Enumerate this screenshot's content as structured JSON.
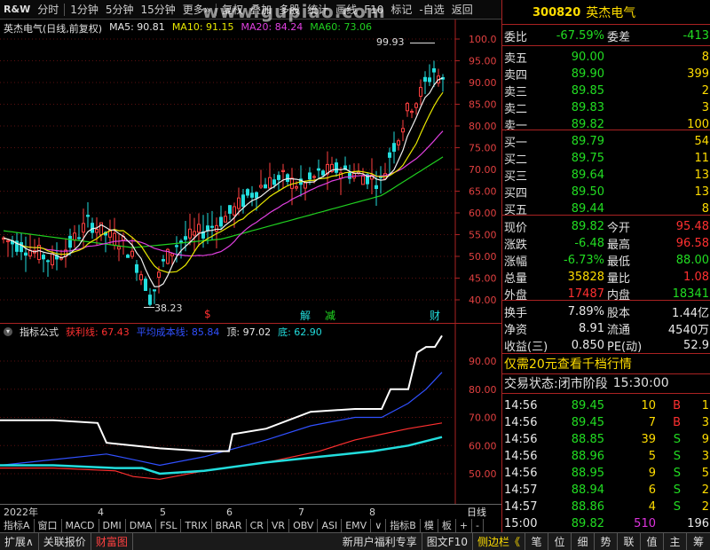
{
  "toolbar": {
    "logo_text": "R&W",
    "items": [
      "分时",
      "1分钟",
      "5分钟",
      "15分钟",
      "更多»",
      "复权",
      "叠加",
      "多股",
      "统计",
      "画线",
      "F10",
      "标记",
      "-自选",
      "返回"
    ]
  },
  "watermark": "www.gupiao.com",
  "chart": {
    "title": "英杰电气(日线,前复权)",
    "ma": [
      {
        "label": "MA5: 90.81",
        "color": "#e8e8e8"
      },
      {
        "label": "MA10: 91.15",
        "color": "#e8e800"
      },
      {
        "label": "MA20: 84.24",
        "color": "#e040e0"
      },
      {
        "label": "MA60: 73.06",
        "color": "#20d020"
      }
    ],
    "high_label": "99.93",
    "low_label": "38.23",
    "price_axis": [
      "100.0",
      "95.00",
      "90.00",
      "85.00",
      "80.00",
      "75.00",
      "70.00",
      "65.00",
      "60.00",
      "55.00",
      "50.00",
      "45.00",
      "40.00"
    ],
    "events": [
      {
        "label": "$",
        "color": "#ff3030"
      },
      {
        "label": "解",
        "color": "#22dddd"
      },
      {
        "label": "减",
        "color": "#22dd22"
      },
      {
        "label": "财",
        "color": "#22dddd"
      }
    ]
  },
  "indicator": {
    "title": "指标公式",
    "items": [
      {
        "label": "获利线: 67.43",
        "color": "#ff3030"
      },
      {
        "label": "平均成本线: 85.84",
        "color": "#3050ff"
      },
      {
        "label": "顶: 97.02",
        "color": "#e8e8e8"
      },
      {
        "label": "底: 62.90",
        "color": "#22dddd"
      }
    ],
    "axis": [
      "90.00",
      "80.00",
      "70.00",
      "60.00",
      "50.00"
    ]
  },
  "date_axis": [
    "2022年",
    "4",
    "5",
    "6",
    "7",
    "8"
  ],
  "period_label": "日线",
  "tabs_row1": [
    "指标A",
    "窗口",
    "MACD",
    "DMI",
    "DMA",
    "FSL",
    "TRIX",
    "BRAR",
    "CR",
    "VR",
    "OBV",
    "ASI",
    "EMV",
    "∨",
    "指标B",
    "模",
    "板",
    "+",
    "-"
  ],
  "tabs_row2": [
    "扩展∧",
    "关联报价",
    "财富图"
  ],
  "statusbar": [
    "新用户福利专享",
    "图文F10",
    "侧边栏《",
    "笔",
    "位",
    "细",
    "势",
    "联",
    "值",
    "主",
    "筹"
  ],
  "stock": {
    "code": "300820",
    "name": "英杰电气"
  },
  "webi": {
    "label": "委比",
    "value": "-67.59%",
    "label2": "委差",
    "value2": "-413"
  },
  "asks": [
    {
      "label": "卖五",
      "price": "90.00",
      "vol": "8"
    },
    {
      "label": "卖四",
      "price": "89.90",
      "vol": "399"
    },
    {
      "label": "卖三",
      "price": "89.85",
      "vol": "2"
    },
    {
      "label": "卖二",
      "price": "89.83",
      "vol": "3"
    },
    {
      "label": "卖一",
      "price": "89.82",
      "vol": "100"
    }
  ],
  "bids": [
    {
      "label": "买一",
      "price": "89.79",
      "vol": "54"
    },
    {
      "label": "买二",
      "price": "89.75",
      "vol": "11"
    },
    {
      "label": "买三",
      "price": "89.64",
      "vol": "13"
    },
    {
      "label": "买四",
      "price": "89.50",
      "vol": "13"
    },
    {
      "label": "买五",
      "price": "89.44",
      "vol": "8"
    }
  ],
  "quote": [
    {
      "l1": "现价",
      "v1": "89.82",
      "c1": "g",
      "l2": "今开",
      "v2": "95.48",
      "c2": "r"
    },
    {
      "l1": "涨跌",
      "v1": "-6.48",
      "c1": "g",
      "l2": "最高",
      "v2": "96.58",
      "c2": "r"
    },
    {
      "l1": "涨幅",
      "v1": "-6.73%",
      "c1": "g",
      "l2": "最低",
      "v2": "88.00",
      "c2": "g"
    },
    {
      "l1": "总量",
      "v1": "35828",
      "c1": "y",
      "l2": "量比",
      "v2": "1.08",
      "c2": "r"
    },
    {
      "l1": "外盘",
      "v1": "17487",
      "c1": "r",
      "l2": "内盘",
      "v2": "18341",
      "c2": "g"
    }
  ],
  "stats": [
    {
      "l1": "换手",
      "v1": "7.89%",
      "l2": "股本",
      "v2": "1.44亿"
    },
    {
      "l1": "净资",
      "v1": "8.91",
      "l2": "流通",
      "v2": "4540万"
    },
    {
      "l1": "收益(三)",
      "v1": "0.850",
      "l2": "PE(动)",
      "v2": "52.9"
    }
  ],
  "promo": "仅需20元查看千档行情",
  "trade_state": {
    "label": "交易状态:",
    "state": "闭市阶段",
    "time": "15:30:00"
  },
  "ticks": [
    {
      "time": "14:56",
      "price": "89.45",
      "vol": "10",
      "bs": "B",
      "n": "1"
    },
    {
      "time": "14:56",
      "price": "89.45",
      "vol": "7",
      "bs": "B",
      "n": "3"
    },
    {
      "time": "14:56",
      "price": "88.85",
      "vol": "39",
      "bs": "S",
      "n": "9"
    },
    {
      "time": "14:56",
      "price": "88.96",
      "vol": "5",
      "bs": "S",
      "n": "3"
    },
    {
      "time": "14:56",
      "price": "88.95",
      "vol": "9",
      "bs": "S",
      "n": "5"
    },
    {
      "time": "14:57",
      "price": "88.94",
      "vol": "6",
      "bs": "S",
      "n": "2"
    },
    {
      "time": "14:57",
      "price": "88.86",
      "vol": "4",
      "bs": "S",
      "n": "2"
    },
    {
      "time": "15:00",
      "price": "89.82",
      "vol": "510",
      "bs": "",
      "n": "196"
    }
  ]
}
